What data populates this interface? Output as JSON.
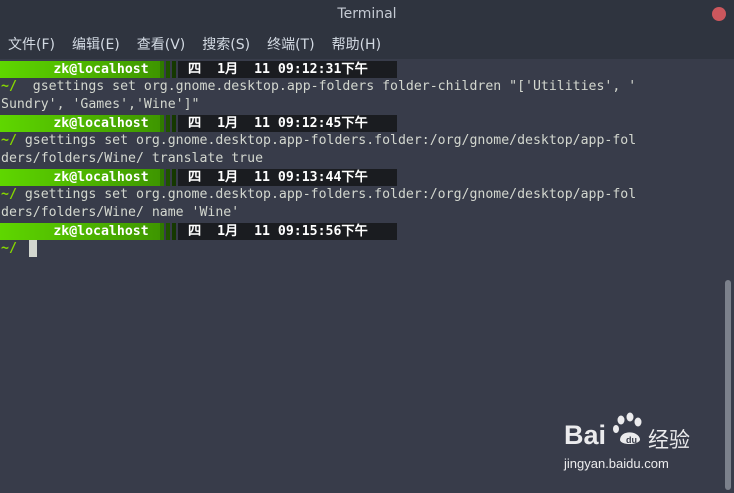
{
  "window": {
    "title": "Terminal"
  },
  "menubar": {
    "items": [
      "文件(F)",
      "编辑(E)",
      "查看(V)",
      "搜索(S)",
      "终端(T)",
      "帮助(H)"
    ]
  },
  "terminal": {
    "prompts": [
      {
        "user": "zk@localhost",
        "datetime": "四  1月  11 09:12:31下午"
      },
      {
        "user": "zk@localhost",
        "datetime": "四  1月  11 09:12:45下午"
      },
      {
        "user": "zk@localhost",
        "datetime": "四  1月  11 09:13:44下午"
      },
      {
        "user": "zk@localhost",
        "datetime": "四  1月  11 09:15:56下午"
      }
    ],
    "cwd": "~/",
    "commands": [
      [
        "  gsettings set org.gnome.desktop.app-folders folder-children \"['Utilities', '",
        "Sundry', 'Games','Wine']\""
      ],
      [
        " gsettings set org.gnome.desktop.app-folders.folder:/org/gnome/desktop/app-fol",
        "ders/folders/Wine/ translate true"
      ],
      [
        " gsettings set org.gnome.desktop.app-folders.folder:/org/gnome/desktop/app-fol",
        "ders/folders/Wine/ name 'Wine'"
      ]
    ]
  },
  "colors": {
    "prompt_green": "#5fd700",
    "prompt_dark": "#1a1c20",
    "tilde_green": "#87d700",
    "background": "#383c4a"
  },
  "watermark": {
    "logo": "Bai",
    "logo_cn": "经验",
    "url": "jingyan.baidu.com"
  }
}
